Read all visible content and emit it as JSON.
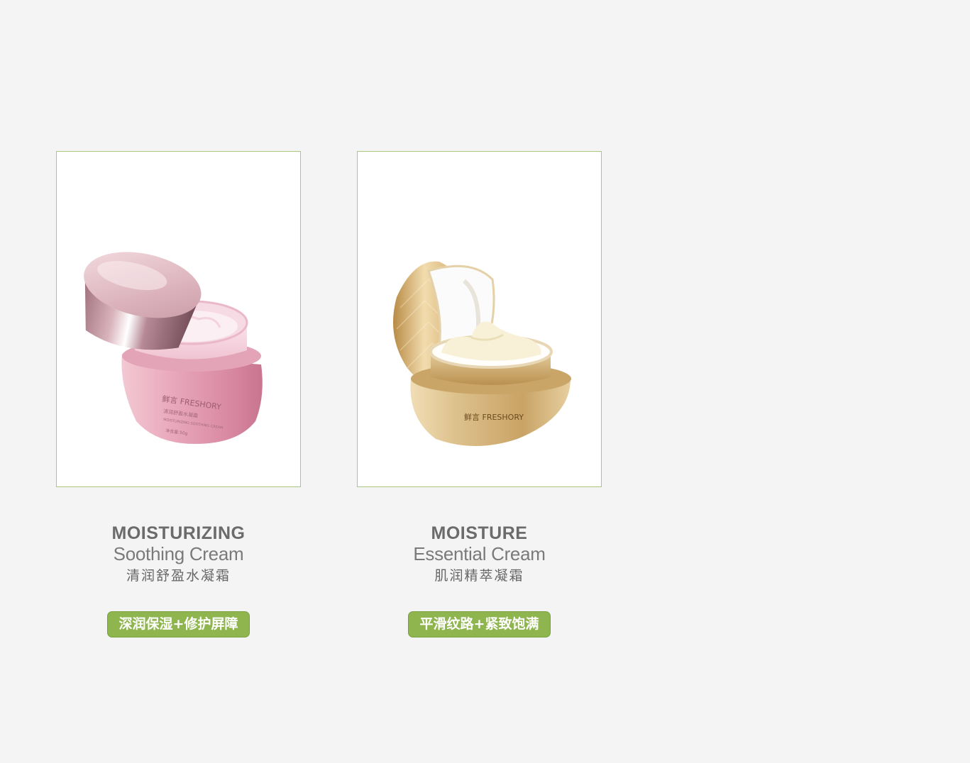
{
  "products": [
    {
      "title_main": "MOISTURIZING",
      "title_sub": "Soothing Cream",
      "title_cn": "清润舒盈水凝霜",
      "benefit": "深润保湿+修护屏障",
      "image_label": "pink-cream-jar",
      "jar_brand": "鲜言 FRESHORY",
      "jar_label": "清润舒盈水凝霜",
      "jar_small": "MOISTURIZING SOOTHING CREAM",
      "jar_net": "净含量:50g",
      "colors": {
        "jar": "#e8a9bb",
        "cap": "#d9b4bd"
      }
    },
    {
      "title_main": "MOISTURE",
      "title_sub": "Essential Cream",
      "title_cn": "肌润精萃凝霜",
      "benefit": "平滑纹路+紧致饱满",
      "image_label": "gold-cream-jar",
      "jar_brand": "鲜言 FRESHORY",
      "colors": {
        "jar": "#d8b57c",
        "cap": "#e2c795"
      }
    }
  ],
  "colors": {
    "background": "#f4f4f4",
    "frame_border": "#a9c77e",
    "tag_bg": "#8fb54e",
    "text": "#6b6b6b"
  }
}
